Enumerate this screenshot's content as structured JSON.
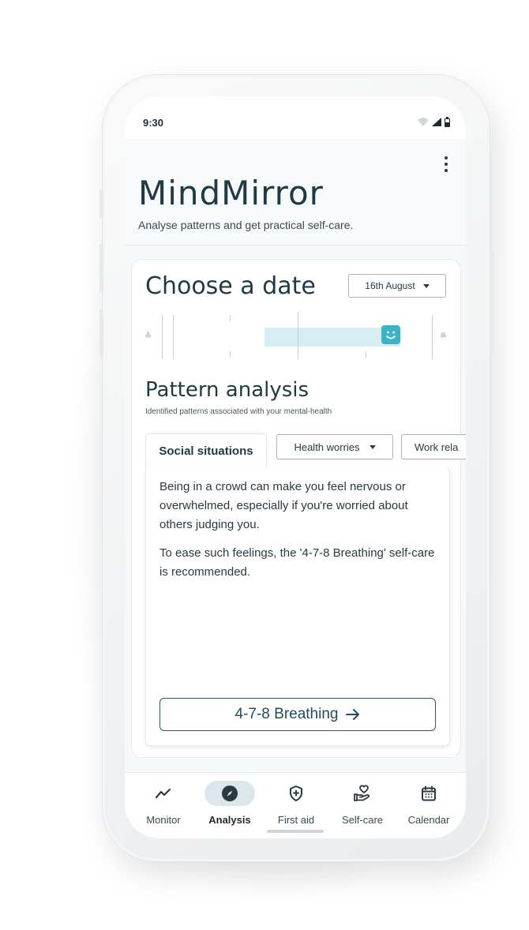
{
  "status_bar": {
    "time": "9:30"
  },
  "app": {
    "title": "MindMirror",
    "subtitle": "Analyse patterns and get practical self-care."
  },
  "date_section": {
    "title": "Choose a date",
    "selected_date": "16th August"
  },
  "pattern_analysis": {
    "title": "Pattern analysis",
    "subtitle": "Identified patterns associated with your mental-health",
    "tabs": [
      {
        "label": "Social situations",
        "selected": true
      },
      {
        "label": "Health worries",
        "dropdown": true
      },
      {
        "label": "Work rela"
      }
    ],
    "paragraph_1": "Being in a crowd can make you feel nervous or overwhelmed, especially if you're worried about others judging you.",
    "paragraph_2": "To ease such feelings, the '4-7-8 Breathing' self-care is recommended.",
    "cta_label": "4-7-8 Breathing"
  },
  "bottom_nav": [
    {
      "label": "Monitor",
      "icon": "trend-icon"
    },
    {
      "label": "Analysis",
      "icon": "compass-icon",
      "active": true
    },
    {
      "label": "First aid",
      "icon": "shield-plus-icon"
    },
    {
      "label": "Self-care",
      "icon": "heart-hand-icon"
    },
    {
      "label": "Calendar",
      "icon": "calendar-icon"
    }
  ],
  "colors": {
    "accent": "#3db3c5",
    "primary_text": "#1f3a44",
    "cta_border": "#2d5a6a"
  }
}
